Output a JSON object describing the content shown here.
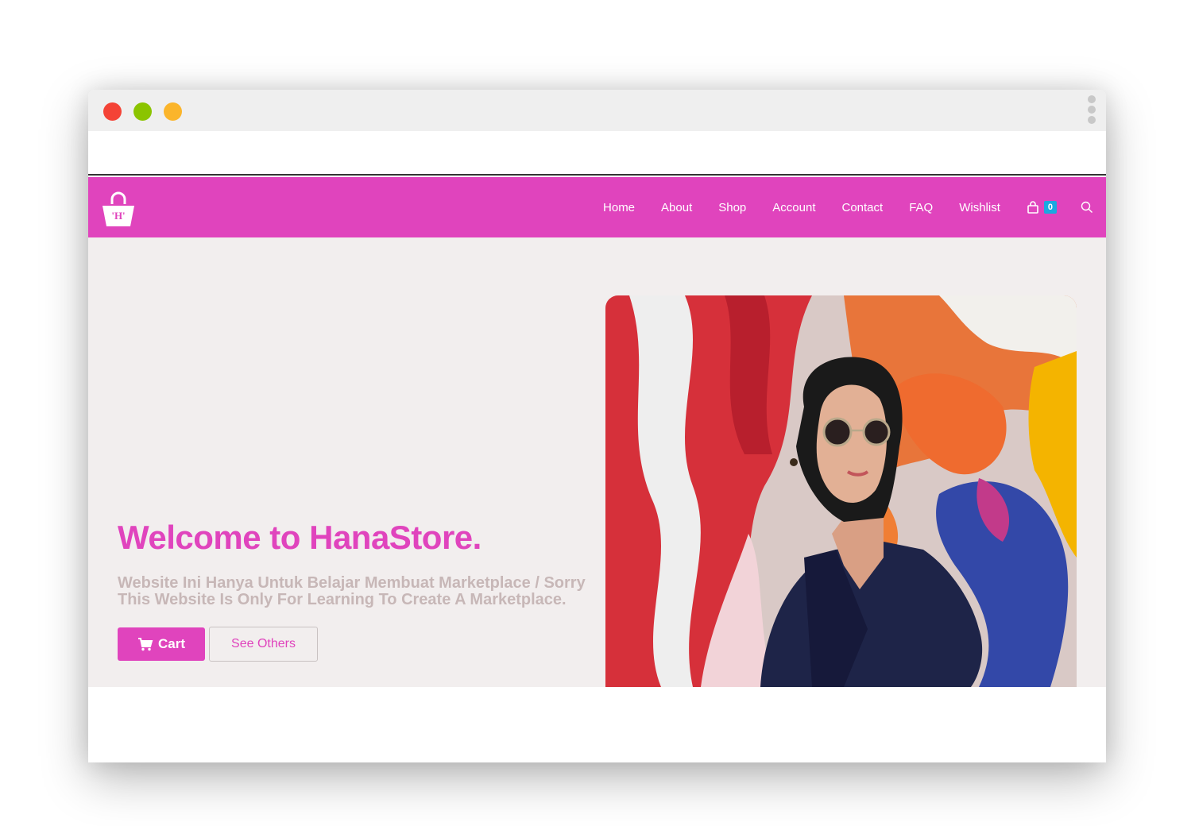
{
  "window": {
    "controls": [
      "close",
      "minimize",
      "maximize"
    ],
    "menu_icon": "kebab-menu-icon"
  },
  "brand": {
    "logo_text": "'H'",
    "logo_icon": "shopping-bag-icon",
    "accent_color": "#e044bd"
  },
  "nav": {
    "items": [
      {
        "label": "Home"
      },
      {
        "label": "About"
      },
      {
        "label": "Shop"
      },
      {
        "label": "Account"
      },
      {
        "label": "Contact"
      },
      {
        "label": "FAQ"
      },
      {
        "label": "Wishlist"
      }
    ],
    "cart_count": "0",
    "cart_icon": "bag-icon",
    "search_icon": "search-icon",
    "badge_color": "#1ba8e0"
  },
  "hero": {
    "title": "Welcome to HanaStore.",
    "subtitle": "Website Ini Hanya Untuk Belajar Membuat Marketplace / Sorry This Website Is Only For Learning To Create A Marketplace.",
    "cart_button": "Cart",
    "cart_button_icon": "cart-icon",
    "others_button": "See Others",
    "subtitle_color": "#c7b7b7"
  }
}
